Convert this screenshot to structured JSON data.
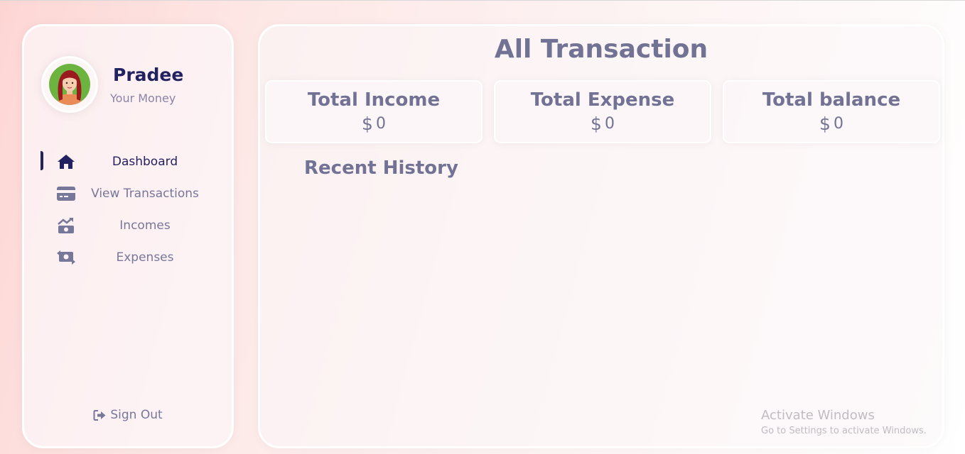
{
  "user": {
    "name": "Pradee",
    "tagline": "Your Money",
    "avatar_icon": "woman-avatar-icon"
  },
  "sidebar": {
    "items": [
      {
        "label": "Dashboard",
        "icon": "home-icon",
        "active": true
      },
      {
        "label": "View Transactions",
        "icon": "credit-card-icon",
        "active": false
      },
      {
        "label": "Incomes",
        "icon": "money-trend-icon",
        "active": false
      },
      {
        "label": "Expenses",
        "icon": "money-exchange-icon",
        "active": false
      }
    ],
    "signout_label": "Sign Out",
    "signout_icon": "sign-out-icon"
  },
  "main": {
    "title": "All Transaction",
    "cards": [
      {
        "title": "Total Income",
        "currency": "$",
        "value": "0"
      },
      {
        "title": "Total Expense",
        "currency": "$",
        "value": "0"
      },
      {
        "title": "Total balance",
        "currency": "$",
        "value": "0"
      }
    ],
    "recent_title": "Recent History"
  },
  "watermark": {
    "title": "Activate Windows",
    "subtitle": "Go to Settings to activate Windows."
  },
  "colors": {
    "primary": "#222260",
    "muted": "#77779a",
    "heading": "#727294"
  }
}
